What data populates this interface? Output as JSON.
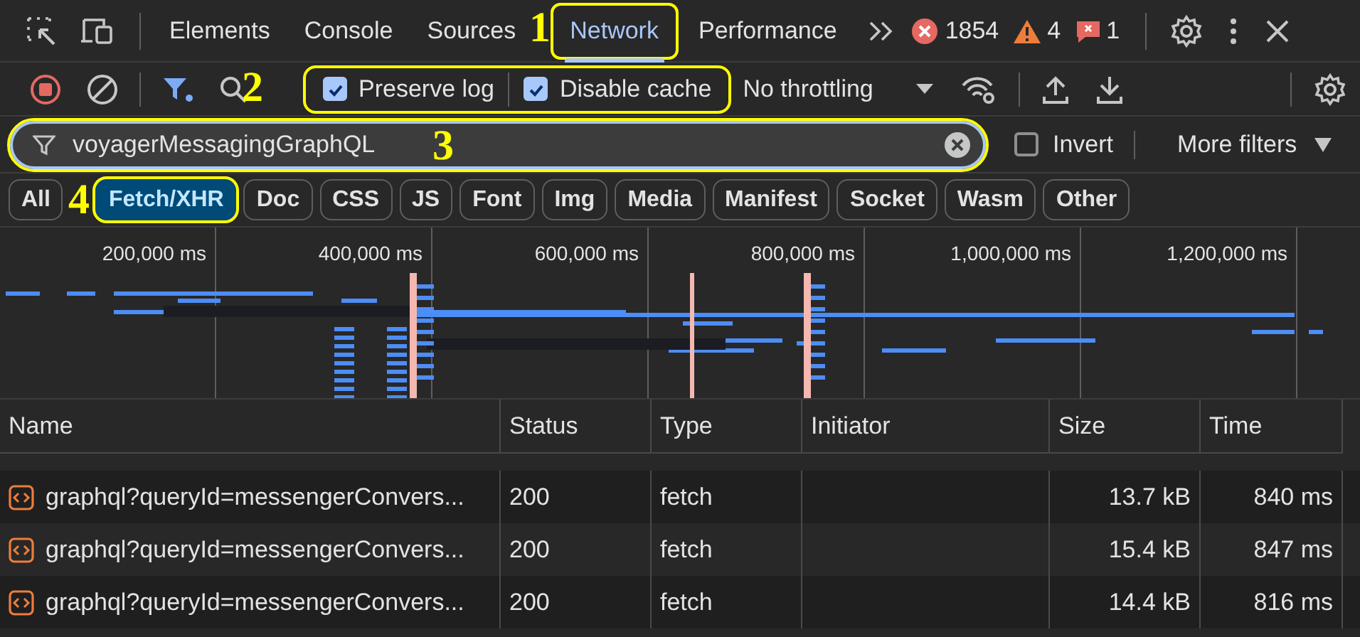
{
  "tab_bar": {
    "tabs": [
      {
        "label": "Elements",
        "selected": false
      },
      {
        "label": "Console",
        "selected": false
      },
      {
        "label": "Sources",
        "selected": false
      },
      {
        "label": "Network",
        "selected": true,
        "annotation": "1"
      },
      {
        "label": "Performance",
        "selected": false
      }
    ],
    "errors": "1854",
    "warnings": "4",
    "issues": "1"
  },
  "toolbar": {
    "annotation": "2",
    "checkboxes": [
      {
        "label": "Preserve log",
        "checked": true
      },
      {
        "label": "Disable cache",
        "checked": true
      }
    ],
    "throttling": "No throttling"
  },
  "filter": {
    "value": "voyagerMessagingGraphQL",
    "annotation": "3",
    "invert": {
      "label": "Invert",
      "checked": false
    },
    "more_filters": "More filters"
  },
  "type_filters": [
    {
      "label": "All",
      "selected": false
    },
    {
      "label": "Fetch/XHR",
      "selected": true,
      "annotation": "4"
    },
    {
      "label": "Doc",
      "selected": false
    },
    {
      "label": "CSS",
      "selected": false
    },
    {
      "label": "JS",
      "selected": false
    },
    {
      "label": "Font",
      "selected": false
    },
    {
      "label": "Img",
      "selected": false
    },
    {
      "label": "Media",
      "selected": false
    },
    {
      "label": "Manifest",
      "selected": false
    },
    {
      "label": "Socket",
      "selected": false
    },
    {
      "label": "Wasm",
      "selected": false
    },
    {
      "label": "Other",
      "selected": false
    }
  ],
  "overview": {
    "ticks": [
      "200,000 ms",
      "400,000 ms",
      "600,000 ms",
      "800,000 ms",
      "1,000,000 ms",
      "1,200,000 ms"
    ]
  },
  "table": {
    "columns": [
      "Name",
      "Status",
      "Type",
      "Initiator",
      "Size",
      "Time"
    ],
    "rows": [
      {
        "name": "graphql?queryId=messengerConvers...",
        "status": "200",
        "type": "fetch",
        "size": "13.7 kB",
        "time": "840 ms"
      },
      {
        "name": "graphql?queryId=messengerConvers...",
        "status": "200",
        "type": "fetch",
        "size": "15.4 kB",
        "time": "847 ms"
      },
      {
        "name": "graphql?queryId=messengerConvers...",
        "status": "200",
        "type": "fetch",
        "size": "14.4 kB",
        "time": "816 ms"
      }
    ]
  }
}
